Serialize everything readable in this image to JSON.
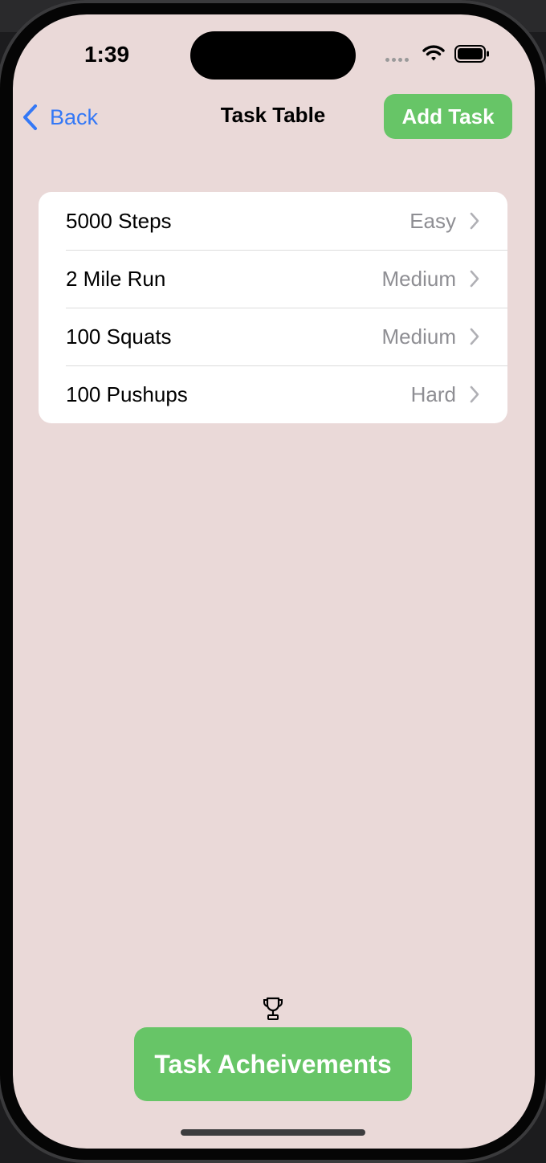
{
  "status_bar": {
    "time": "1:39",
    "wifi_icon": "wifi-icon",
    "battery_icon": "battery-icon"
  },
  "nav": {
    "back_label": "Back",
    "title": "Task Table",
    "add_label": "Add Task"
  },
  "tasks": [
    {
      "name": "5000 Steps",
      "difficulty": "Easy"
    },
    {
      "name": "2 Mile Run",
      "difficulty": "Medium"
    },
    {
      "name": "100 Squats",
      "difficulty": "Medium"
    },
    {
      "name": "100 Pushups",
      "difficulty": "Hard"
    }
  ],
  "achievements": {
    "icon": "trophy-icon",
    "label": "Task Acheivements"
  },
  "colors": {
    "background": "#ead9d8",
    "accent_green": "#67c567",
    "link_blue": "#3478f6",
    "secondary_text": "#8e8e93"
  }
}
